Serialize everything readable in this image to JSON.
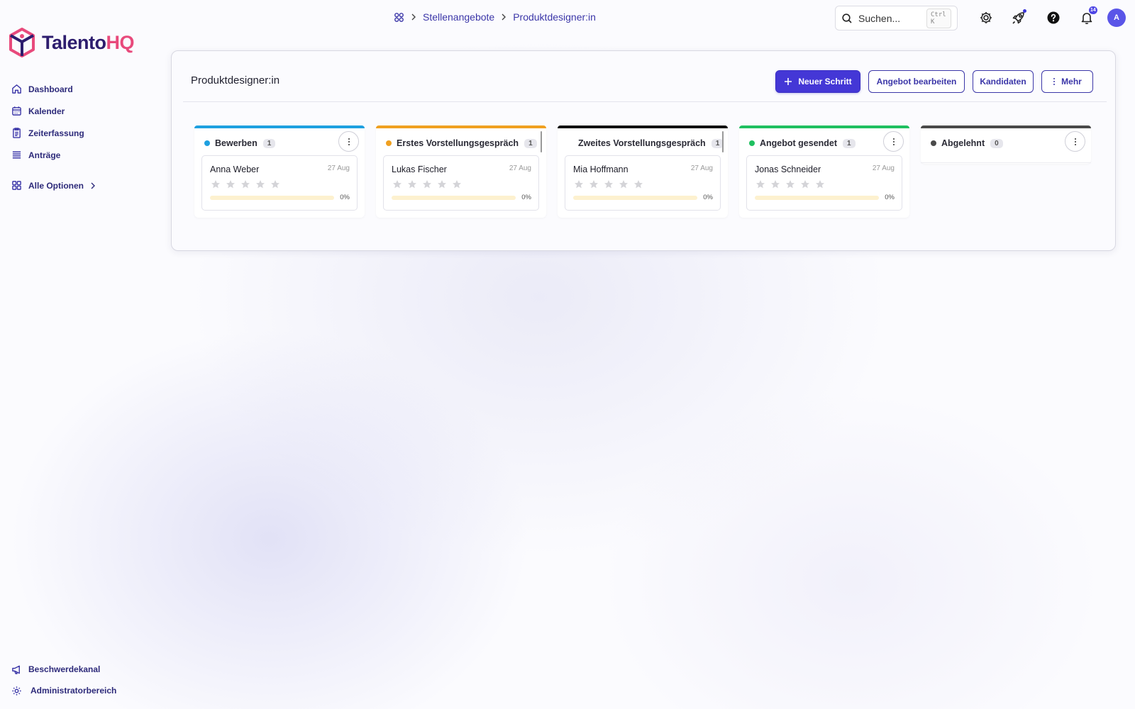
{
  "app": {
    "brand_main": "Talento",
    "brand_accent": "HQ",
    "brand_colors": {
      "primary": "#2d1d6e",
      "accent": "#e84a7c"
    }
  },
  "sidebar": {
    "items": [
      {
        "label": "Dashboard",
        "icon": "home-icon"
      },
      {
        "label": "Kalender",
        "icon": "calendar-icon"
      },
      {
        "label": "Zeiterfassung",
        "icon": "timesheet-icon"
      },
      {
        "label": "Anträge",
        "icon": "list-icon"
      }
    ],
    "all_options": "Alle Optionen",
    "bottom": [
      {
        "label": "Beschwerdekanal",
        "icon": "megaphone-icon"
      },
      {
        "label": "Administratorbereich",
        "icon": "gear-icon"
      }
    ]
  },
  "header": {
    "breadcrumb": [
      "Stellenangebote",
      "Produktdesigner:in"
    ],
    "search_placeholder": "Suchen...",
    "search_shortcut": "Ctrl K",
    "notification_count": "14",
    "avatar_initial": "A"
  },
  "main": {
    "title": "Produktdesigner:in",
    "actions": {
      "new_step": "Neuer Schritt",
      "edit_offer": "Angebot bearbeiten",
      "candidates": "Kandidaten",
      "more": "Mehr"
    },
    "columns": [
      {
        "title": "Bewerben",
        "count": "1",
        "color": "#1ea0e0",
        "cards": [
          {
            "name": "Anna Weber",
            "date": "27 Aug",
            "rating": 0,
            "progress": 0,
            "progress_label": "0%"
          }
        ]
      },
      {
        "title": "Erstes Vorstellungsgespräch",
        "count": "1",
        "color": "#f0a020",
        "cards": [
          {
            "name": "Lukas Fischer",
            "date": "27 Aug",
            "rating": 0,
            "progress": 0,
            "progress_label": "0%"
          }
        ]
      },
      {
        "title": "Zweites Vorstellungsgespräch",
        "count": "1",
        "color": "#111111",
        "cards": [
          {
            "name": "Mia Hoffmann",
            "date": "27 Aug",
            "rating": 0,
            "progress": 0,
            "progress_label": "0%"
          }
        ]
      },
      {
        "title": "Angebot gesendet",
        "count": "1",
        "color": "#1fc060",
        "cards": [
          {
            "name": "Jonas Schneider",
            "date": "27 Aug",
            "rating": 0,
            "progress": 0,
            "progress_label": "0%"
          }
        ]
      },
      {
        "title": "Abgelehnt",
        "count": "0",
        "color": "#4a4a4a",
        "cards": []
      }
    ]
  }
}
